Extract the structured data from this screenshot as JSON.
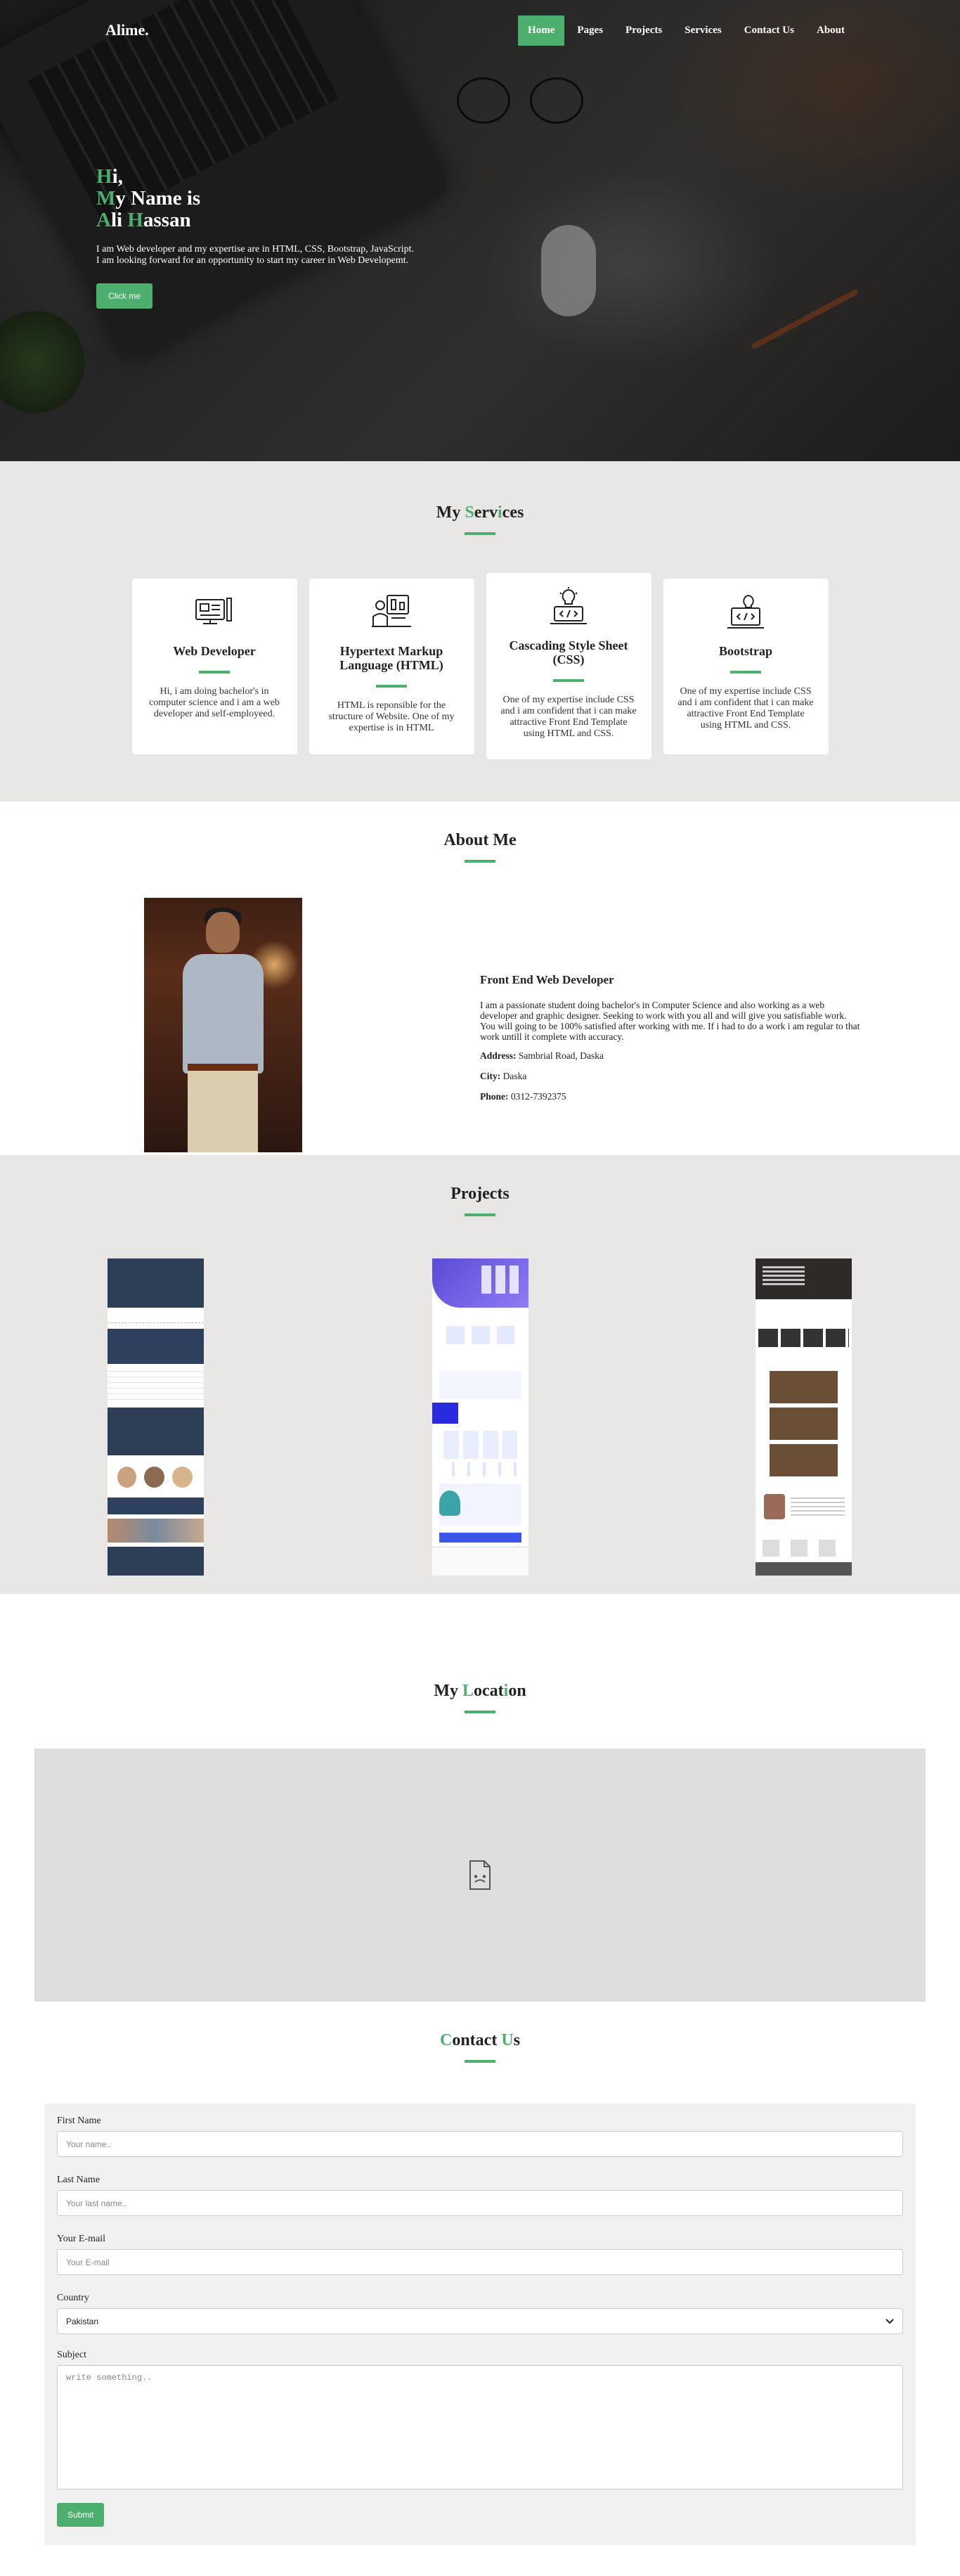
{
  "nav": {
    "brand": "Alime.",
    "items": [
      {
        "label": "Home",
        "active": true
      },
      {
        "label": "Pages",
        "active": false
      },
      {
        "label": "Projects",
        "active": false
      },
      {
        "label": "Services",
        "active": false
      },
      {
        "label": "Contact Us",
        "active": false
      },
      {
        "label": "About",
        "active": false
      }
    ]
  },
  "hero": {
    "line1_first": "H",
    "line1_rest": "i,",
    "line2_first": "M",
    "line2_rest": "y Name is",
    "line3_first": "A",
    "line3_mid": "li ",
    "line3_second": "H",
    "line3_rest": "assan",
    "desc1": "I am Web developer and my expertise are in HTML, CSS, Bootstrap, JavaScript.",
    "desc2": "I am looking forward for an opportunity to start my career in Web Developemt.",
    "button": "Click me"
  },
  "services": {
    "title_a": "My ",
    "title_b": "S",
    "title_c": "erv",
    "title_d": "i",
    "title_e": "ces",
    "cards": [
      {
        "icon": "web-developer-icon",
        "title": "Web Developer",
        "text": "Hi, i am doing bachelor's in computer science and i am a web developer and self-employeed."
      },
      {
        "icon": "html-icon",
        "title": "Hypertext Markup Language (HTML)",
        "text": "HTML is reponsible for the structure of Website. One of my expertise is in HTML"
      },
      {
        "icon": "css-icon",
        "title": "Cascading Style Sheet (CSS)",
        "text": "One of my expertise include CSS and i am confident that i can make attractive Front End Template using HTML and CSS."
      },
      {
        "icon": "bootstrap-icon",
        "title": "Bootstrap",
        "text": "One of my expertise include CSS and i am confident that i can make attractive Front End Template using HTML and CSS."
      }
    ]
  },
  "about": {
    "title": "About Me",
    "role": "Front End Web Developer",
    "paragraph": "I am a passionate student doing bachelor's in Computer Science and also working as a web developer and graphic designer. Seeking to work with you all and will give you satisfiable work. You will going to be 100% satisfied after working with me. If i had to do a work i am regular to that work untill it complete with accuracy.",
    "address_label": "Address:",
    "address": "Sambrial Road, Daska",
    "city_label": "City:",
    "city": "Daska",
    "phone_label": "Phone:",
    "phone": "0312-7392375"
  },
  "projects": {
    "title": "Projects"
  },
  "location": {
    "title_a": "My ",
    "title_b": "L",
    "title_c": "ocat",
    "title_d": "i",
    "title_e": "on",
    "map_icon": "broken-document-icon"
  },
  "contact": {
    "title_a": "C",
    "title_b": "ontact ",
    "title_c": "U",
    "title_d": "s",
    "first_name_label": "First Name",
    "first_name_placeholder": "Your name..",
    "last_name_label": "Last Name",
    "last_name_placeholder": "Your last name..",
    "email_label": "Your E-mail",
    "email_placeholder": "Your E-mail",
    "country_label": "Country",
    "country_value": "Pakistan",
    "subject_label": "Subject",
    "subject_placeholder": "write something..",
    "submit": "Submit"
  },
  "colors": {
    "accent": "#4caf6e",
    "section_gray": "#e8e7e5"
  }
}
